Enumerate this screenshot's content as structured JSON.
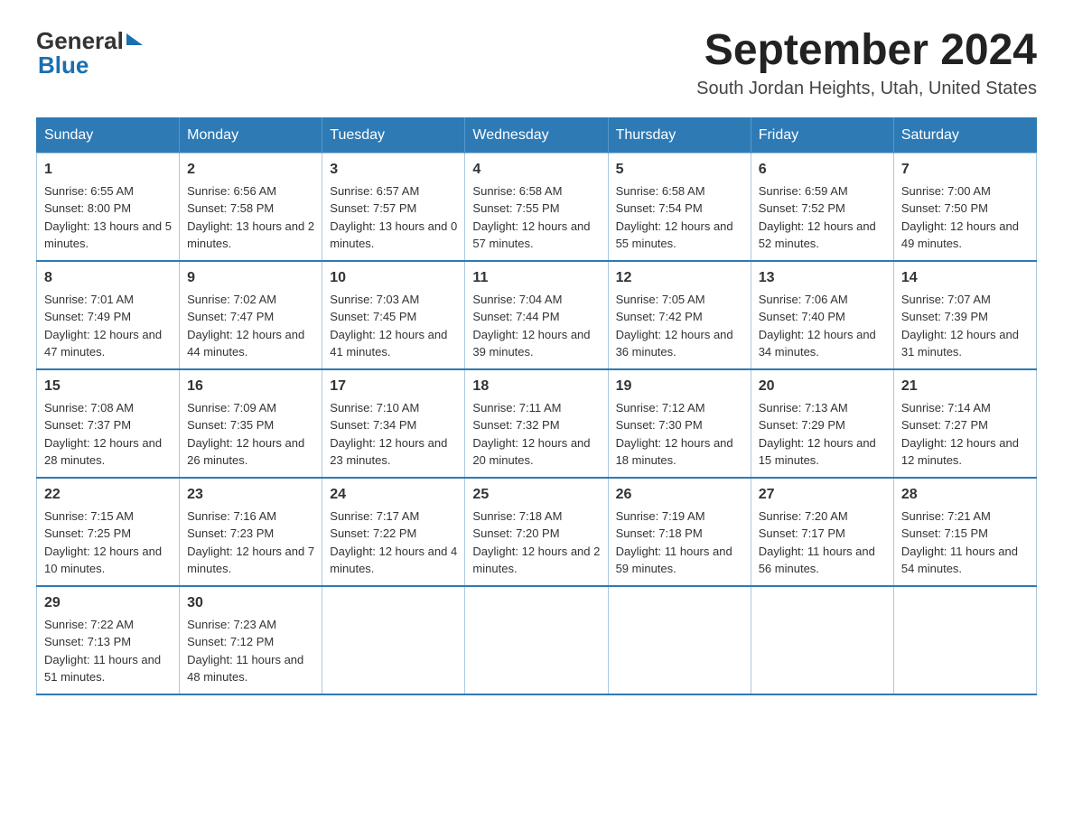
{
  "header": {
    "logo_general": "General",
    "logo_blue": "Blue",
    "month_year": "September 2024",
    "location": "South Jordan Heights, Utah, United States"
  },
  "days_of_week": [
    "Sunday",
    "Monday",
    "Tuesday",
    "Wednesday",
    "Thursday",
    "Friday",
    "Saturday"
  ],
  "weeks": [
    [
      {
        "day": "1",
        "sunrise": "6:55 AM",
        "sunset": "8:00 PM",
        "daylight": "13 hours and 5 minutes."
      },
      {
        "day": "2",
        "sunrise": "6:56 AM",
        "sunset": "7:58 PM",
        "daylight": "13 hours and 2 minutes."
      },
      {
        "day": "3",
        "sunrise": "6:57 AM",
        "sunset": "7:57 PM",
        "daylight": "13 hours and 0 minutes."
      },
      {
        "day": "4",
        "sunrise": "6:58 AM",
        "sunset": "7:55 PM",
        "daylight": "12 hours and 57 minutes."
      },
      {
        "day": "5",
        "sunrise": "6:58 AM",
        "sunset": "7:54 PM",
        "daylight": "12 hours and 55 minutes."
      },
      {
        "day": "6",
        "sunrise": "6:59 AM",
        "sunset": "7:52 PM",
        "daylight": "12 hours and 52 minutes."
      },
      {
        "day": "7",
        "sunrise": "7:00 AM",
        "sunset": "7:50 PM",
        "daylight": "12 hours and 49 minutes."
      }
    ],
    [
      {
        "day": "8",
        "sunrise": "7:01 AM",
        "sunset": "7:49 PM",
        "daylight": "12 hours and 47 minutes."
      },
      {
        "day": "9",
        "sunrise": "7:02 AM",
        "sunset": "7:47 PM",
        "daylight": "12 hours and 44 minutes."
      },
      {
        "day": "10",
        "sunrise": "7:03 AM",
        "sunset": "7:45 PM",
        "daylight": "12 hours and 41 minutes."
      },
      {
        "day": "11",
        "sunrise": "7:04 AM",
        "sunset": "7:44 PM",
        "daylight": "12 hours and 39 minutes."
      },
      {
        "day": "12",
        "sunrise": "7:05 AM",
        "sunset": "7:42 PM",
        "daylight": "12 hours and 36 minutes."
      },
      {
        "day": "13",
        "sunrise": "7:06 AM",
        "sunset": "7:40 PM",
        "daylight": "12 hours and 34 minutes."
      },
      {
        "day": "14",
        "sunrise": "7:07 AM",
        "sunset": "7:39 PM",
        "daylight": "12 hours and 31 minutes."
      }
    ],
    [
      {
        "day": "15",
        "sunrise": "7:08 AM",
        "sunset": "7:37 PM",
        "daylight": "12 hours and 28 minutes."
      },
      {
        "day": "16",
        "sunrise": "7:09 AM",
        "sunset": "7:35 PM",
        "daylight": "12 hours and 26 minutes."
      },
      {
        "day": "17",
        "sunrise": "7:10 AM",
        "sunset": "7:34 PM",
        "daylight": "12 hours and 23 minutes."
      },
      {
        "day": "18",
        "sunrise": "7:11 AM",
        "sunset": "7:32 PM",
        "daylight": "12 hours and 20 minutes."
      },
      {
        "day": "19",
        "sunrise": "7:12 AM",
        "sunset": "7:30 PM",
        "daylight": "12 hours and 18 minutes."
      },
      {
        "day": "20",
        "sunrise": "7:13 AM",
        "sunset": "7:29 PM",
        "daylight": "12 hours and 15 minutes."
      },
      {
        "day": "21",
        "sunrise": "7:14 AM",
        "sunset": "7:27 PM",
        "daylight": "12 hours and 12 minutes."
      }
    ],
    [
      {
        "day": "22",
        "sunrise": "7:15 AM",
        "sunset": "7:25 PM",
        "daylight": "12 hours and 10 minutes."
      },
      {
        "day": "23",
        "sunrise": "7:16 AM",
        "sunset": "7:23 PM",
        "daylight": "12 hours and 7 minutes."
      },
      {
        "day": "24",
        "sunrise": "7:17 AM",
        "sunset": "7:22 PM",
        "daylight": "12 hours and 4 minutes."
      },
      {
        "day": "25",
        "sunrise": "7:18 AM",
        "sunset": "7:20 PM",
        "daylight": "12 hours and 2 minutes."
      },
      {
        "day": "26",
        "sunrise": "7:19 AM",
        "sunset": "7:18 PM",
        "daylight": "11 hours and 59 minutes."
      },
      {
        "day": "27",
        "sunrise": "7:20 AM",
        "sunset": "7:17 PM",
        "daylight": "11 hours and 56 minutes."
      },
      {
        "day": "28",
        "sunrise": "7:21 AM",
        "sunset": "7:15 PM",
        "daylight": "11 hours and 54 minutes."
      }
    ],
    [
      {
        "day": "29",
        "sunrise": "7:22 AM",
        "sunset": "7:13 PM",
        "daylight": "11 hours and 51 minutes."
      },
      {
        "day": "30",
        "sunrise": "7:23 AM",
        "sunset": "7:12 PM",
        "daylight": "11 hours and 48 minutes."
      },
      null,
      null,
      null,
      null,
      null
    ]
  ]
}
